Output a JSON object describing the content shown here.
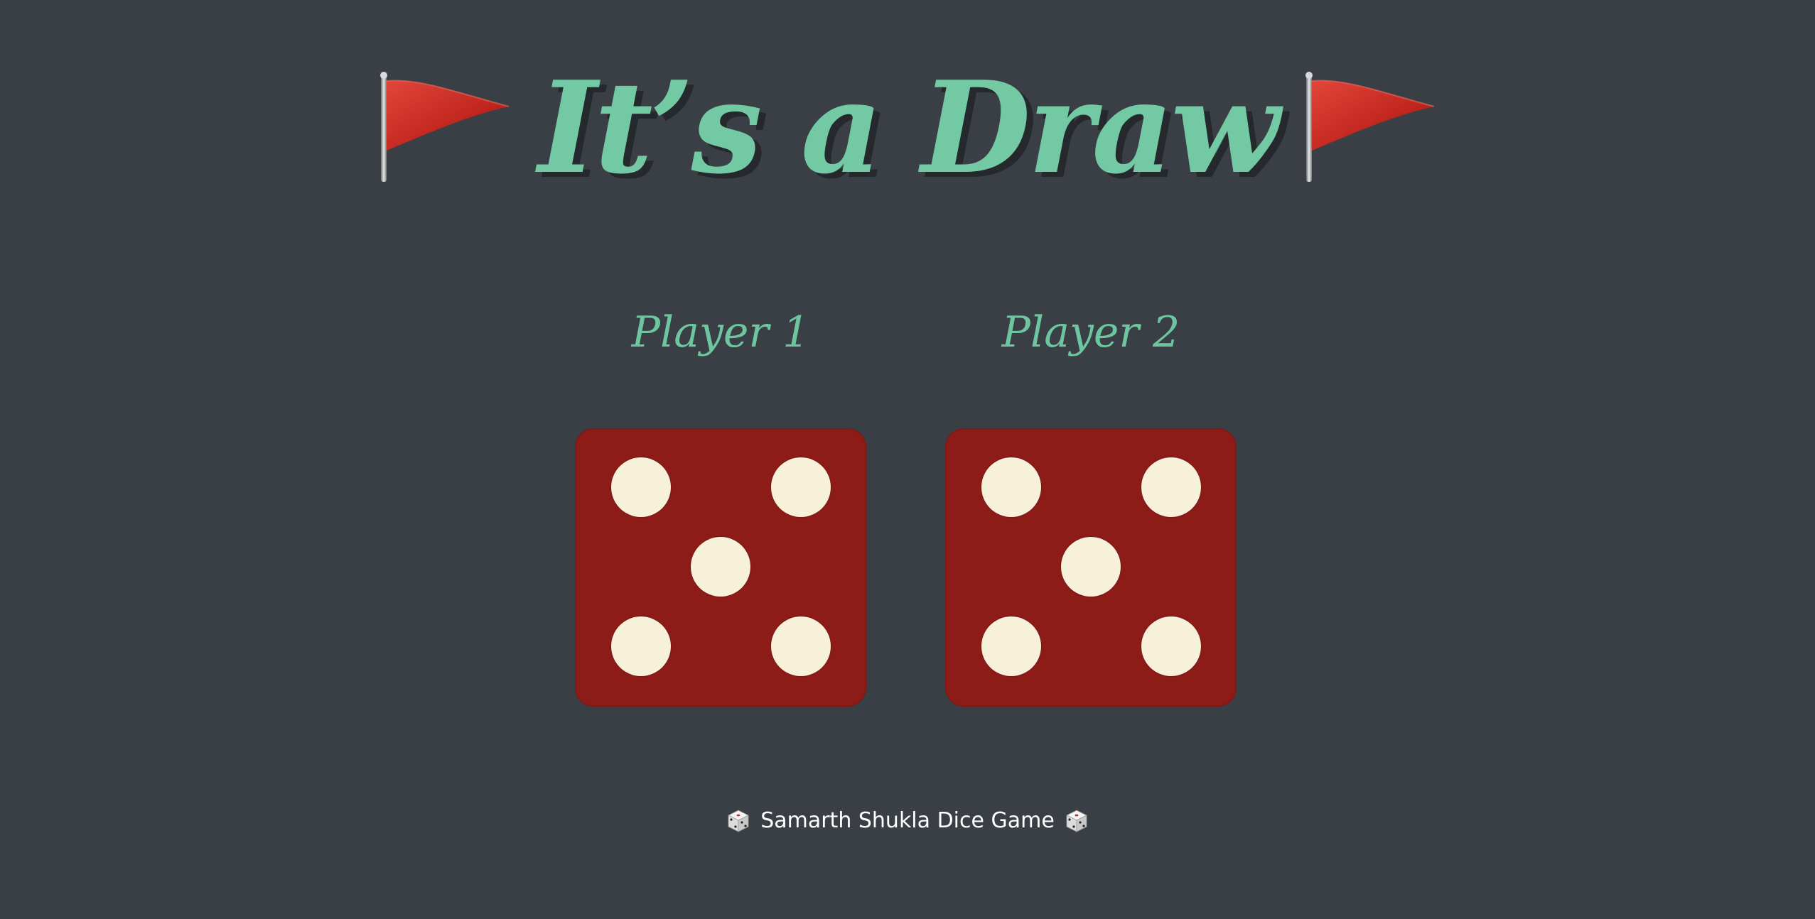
{
  "header": {
    "title": "It’s a Draw",
    "left_icon": "red-flag-icon",
    "right_icon": "red-flag-icon"
  },
  "players": [
    {
      "name": "Player 1",
      "die_value": 5
    },
    {
      "name": "Player 2",
      "die_value": 5
    }
  ],
  "footer": {
    "text": "Samarth Shukla Dice Game",
    "icon": "game-die-icon"
  },
  "colors": {
    "background": "#393f45",
    "accent": "#73c9a4",
    "die": "#8d1c19",
    "pip": "#f7f1da",
    "flag": "#c4281f"
  }
}
